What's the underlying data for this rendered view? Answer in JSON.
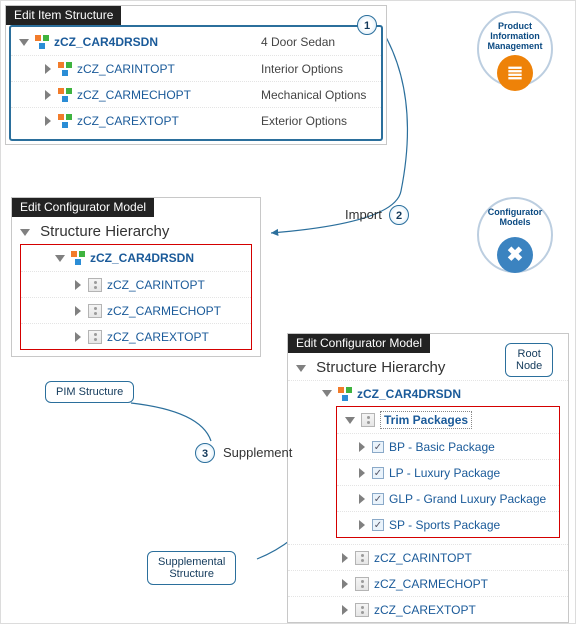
{
  "panels": {
    "p1": {
      "header": "Edit Item Structure",
      "root": {
        "label": "zCZ_CAR4DRSDN",
        "desc": "4 Door Sedan"
      },
      "items": [
        {
          "label": "zCZ_CARINTOPT",
          "desc": "Interior Options"
        },
        {
          "label": "zCZ_CARMECHOPT",
          "desc": "Mechanical Options"
        },
        {
          "label": "zCZ_CAREXTOPT",
          "desc": "Exterior Options"
        }
      ]
    },
    "p2": {
      "header": "Edit Configurator Model",
      "title": "Structure Hierarchy",
      "root": "zCZ_CAR4DRSDN",
      "items": [
        "zCZ_CARINTOPT",
        "zCZ_CARMECHOPT",
        "zCZ_CAREXTOPT"
      ]
    },
    "p3": {
      "header": "Edit Configurator Model",
      "title": "Structure Hierarchy",
      "root": "zCZ_CAR4DRSDN",
      "supp_root": "Trim Packages",
      "supp_items": [
        "BP - Basic Package",
        "LP - Luxury Package",
        "GLP - Grand Luxury Package",
        "SP - Sports Package"
      ],
      "items": [
        "zCZ_CARINTOPT",
        "zCZ_CARMECHOPT",
        "zCZ_CAREXTOPT"
      ]
    }
  },
  "circles": {
    "a_line1": "Product",
    "a_line2": "Information",
    "a_line3": "Management",
    "b_line1": "Configurator",
    "b_line2": "Models"
  },
  "steps": {
    "s1": "1",
    "s2": "2",
    "s3": "3"
  },
  "labels": {
    "import": "Import",
    "supplement": "Supplement",
    "pim": "PIM Structure",
    "root_node": "Root\nNode",
    "supp_struct": "Supplemental\nStructure"
  }
}
